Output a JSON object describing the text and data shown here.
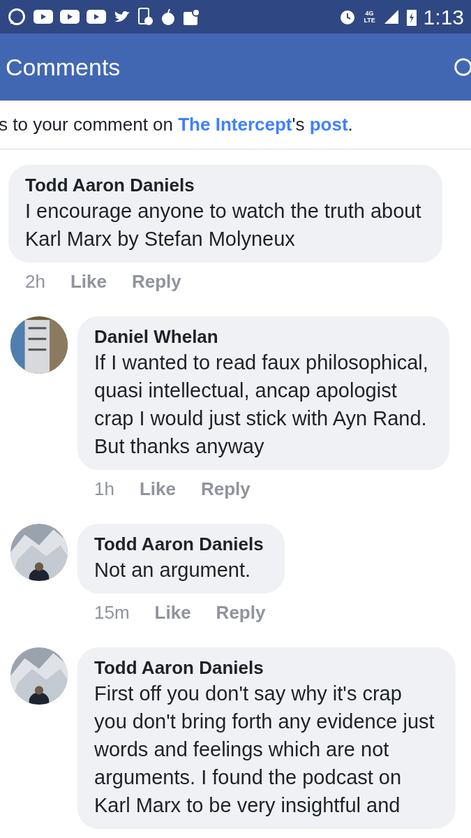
{
  "status_bar": {
    "network": "4G LTE",
    "time": "1:13"
  },
  "header": {
    "title": "Comments"
  },
  "notice": [
    {
      "text": "s to your comment on ",
      "link": false
    },
    {
      "text": "The Intercept",
      "link": true
    },
    {
      "text": "'s ",
      "link": false
    },
    {
      "text": "post",
      "link": true
    },
    {
      "text": ".",
      "link": false
    }
  ],
  "comments": [
    {
      "avatar": false,
      "author": "Todd Aaron Daniels",
      "lines": [
        "I encourage anyone to watch the truth about",
        "Karl Marx by Stefan Molyneux"
      ],
      "time": "2h",
      "like": "Like",
      "reply": "Reply"
    },
    {
      "avatar": true,
      "author": "Daniel Whelan",
      "lines": [
        "If I wanted to read faux philosophical,",
        "quasi intellectual, ancap apologist",
        "crap I would just stick with Ayn Rand.",
        "But thanks anyway"
      ],
      "time": "1h",
      "like": "Like",
      "reply": "Reply"
    },
    {
      "avatar": true,
      "author": "Todd Aaron Daniels",
      "lines": [
        "Not an argument."
      ],
      "time": "15m",
      "like": "Like",
      "reply": "Reply"
    },
    {
      "avatar": true,
      "author": "Todd Aaron Daniels",
      "lines": [
        "First off you don't say why it's crap",
        "you don't bring forth any evidence just",
        "words and feelings which are not",
        "arguments. I found the podcast on",
        "Karl Marx to be very insightful and"
      ]
    }
  ]
}
